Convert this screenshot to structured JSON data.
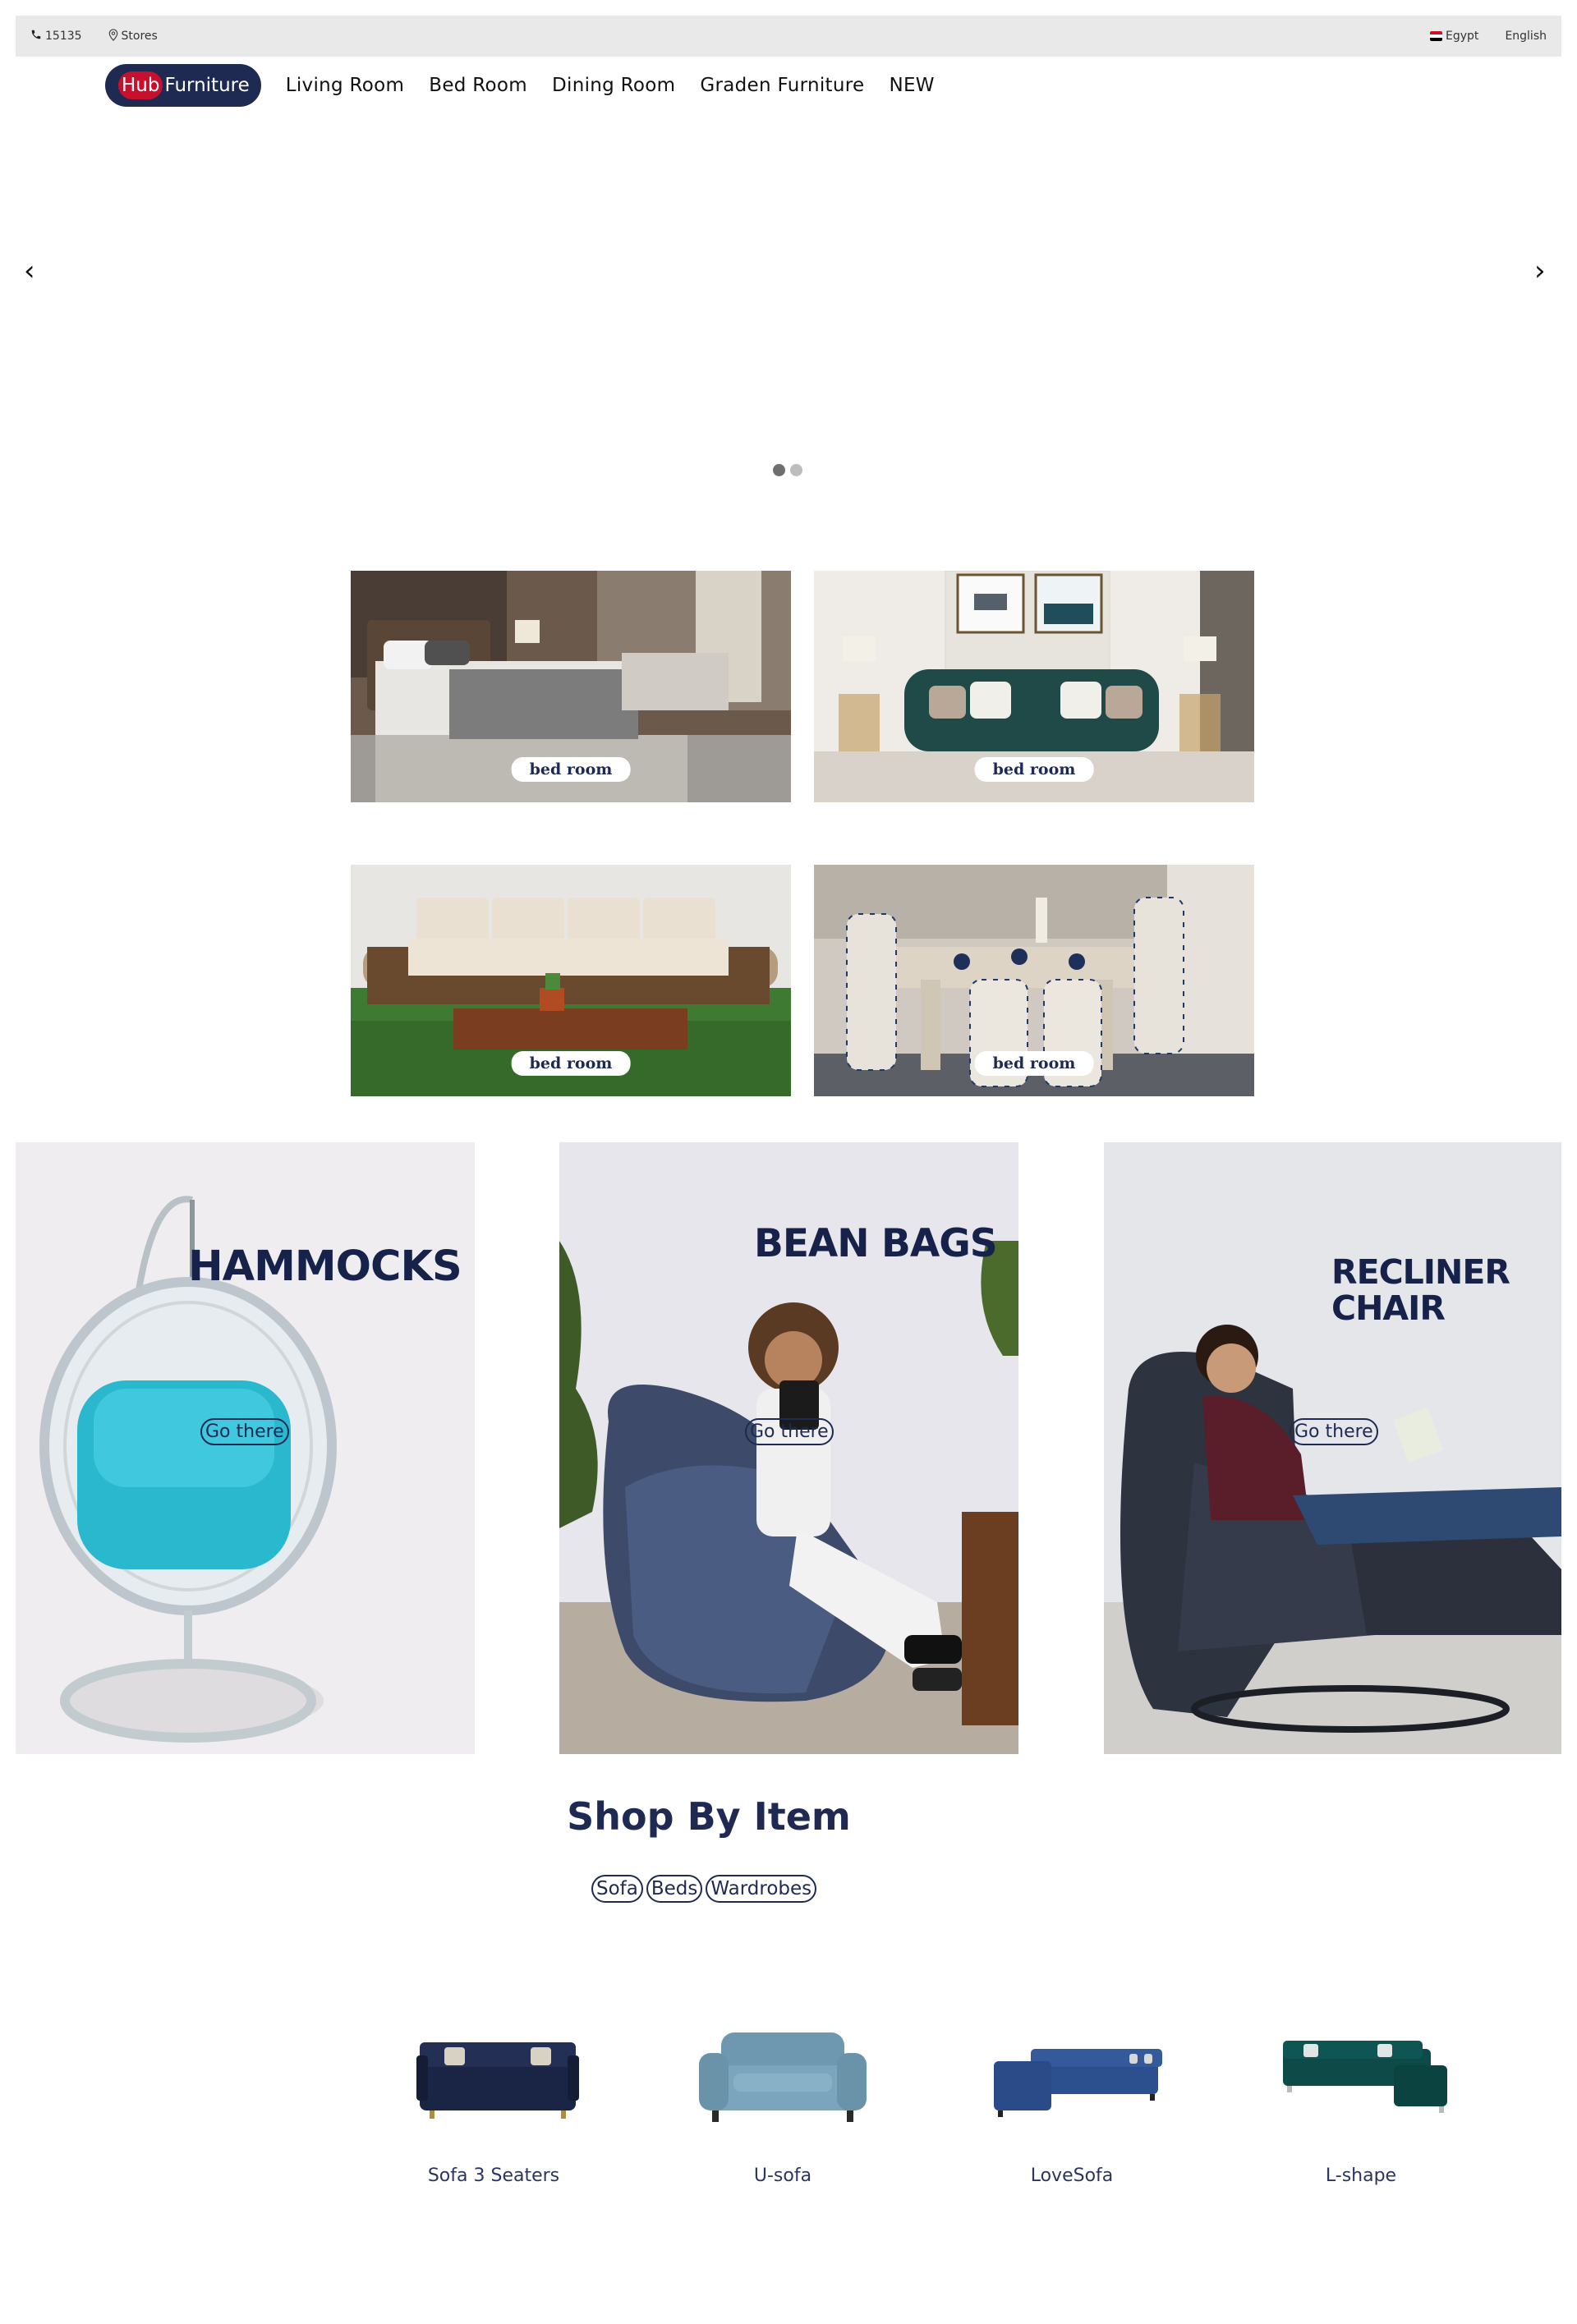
{
  "topbar": {
    "phone": "15135",
    "stores": "Stores",
    "country": "Egypt",
    "language": "English"
  },
  "nav": {
    "logo_hub": "Hub",
    "logo_furniture": "Furniture",
    "links": [
      "Living Room",
      "Bed Room",
      "Dining Room",
      "Graden Furniture",
      "NEW"
    ]
  },
  "slider": {
    "prev": "‹",
    "next": "›",
    "slides": 2,
    "active_slide": 1
  },
  "categories": [
    "bed room",
    "bed room",
    "bed room",
    "bed room"
  ],
  "promos": [
    {
      "title": "HAMMOCKS",
      "button": "Go there"
    },
    {
      "title": "BEAN BAGS",
      "button": "Go there"
    },
    {
      "title_line1": "RECLINER",
      "title_line2": "CHAIR",
      "button": "Go there"
    }
  ],
  "shop": {
    "title": "Shop By Item",
    "chips": [
      "Sofa",
      "Beds",
      "Wardrobes"
    ],
    "products": [
      "Sofa 3 Seaters",
      "U-sofa",
      "LoveSofa",
      "L-shape"
    ]
  },
  "colors": {
    "brand_navy": "#1e2a52",
    "brand_red": "#c8102e",
    "topbar_bg": "#e9e9e9"
  }
}
